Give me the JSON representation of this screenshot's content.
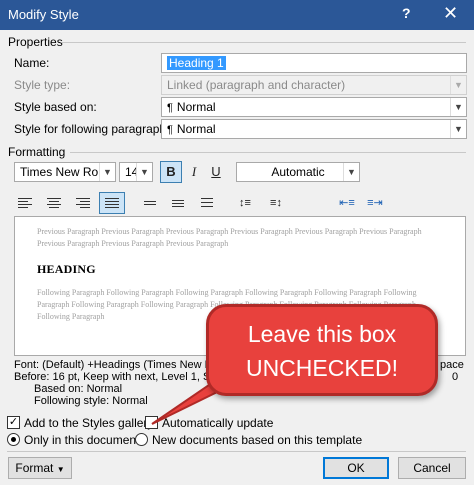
{
  "window": {
    "title": "Modify Style",
    "help": "?",
    "close": "✕"
  },
  "properties": {
    "group_label": "Properties",
    "name_label": "Name:",
    "name_value": "Heading 1",
    "style_type_label": "Style type:",
    "style_type_value": "Linked (paragraph and character)",
    "based_on_label": "Style based on:",
    "based_on_value": "Normal",
    "following_label": "Style for following paragraph:",
    "following_value": "Normal",
    "para_mark": "¶"
  },
  "formatting": {
    "group_label": "Formatting",
    "font": "Times New Roman",
    "size": "14",
    "bold": "B",
    "italic": "I",
    "underline": "U",
    "color": "Automatic",
    "bold_active": true
  },
  "preview": {
    "previous_text": "Previous Paragraph Previous Paragraph Previous Paragraph Previous Paragraph Previous Paragraph Previous Paragraph Previous Paragraph Previous Paragraph Previous Paragraph",
    "heading": "HEADING",
    "following_text": "Following Paragraph Following Paragraph Following Paragraph Following Paragraph Following Paragraph Following Paragraph Following Paragraph Following Paragraph Following Paragraph Following Paragraph Following Paragraph Following Paragraph"
  },
  "description": {
    "line1": "Font: (Default) +Headings (Times New Ro",
    "line1_end": "pace",
    "line2": "Before:  16 pt, Keep with next, Level 1, S",
    "line2_end": "0",
    "line3": "Based on: Normal",
    "line4": "Following style: Normal"
  },
  "options": {
    "add_to_gallery": "Add to the Styles gallery",
    "add_to_gallery_checked": true,
    "auto_update": "Automatically update",
    "auto_update_checked": false,
    "only_this_doc": "Only in this document",
    "new_docs": "New documents based on this template"
  },
  "buttons": {
    "format": "Format",
    "ok": "OK",
    "cancel": "Cancel"
  },
  "callout": {
    "line1": "Leave this box",
    "line2": "UNCHECKED!",
    "color": "#e8413d"
  }
}
